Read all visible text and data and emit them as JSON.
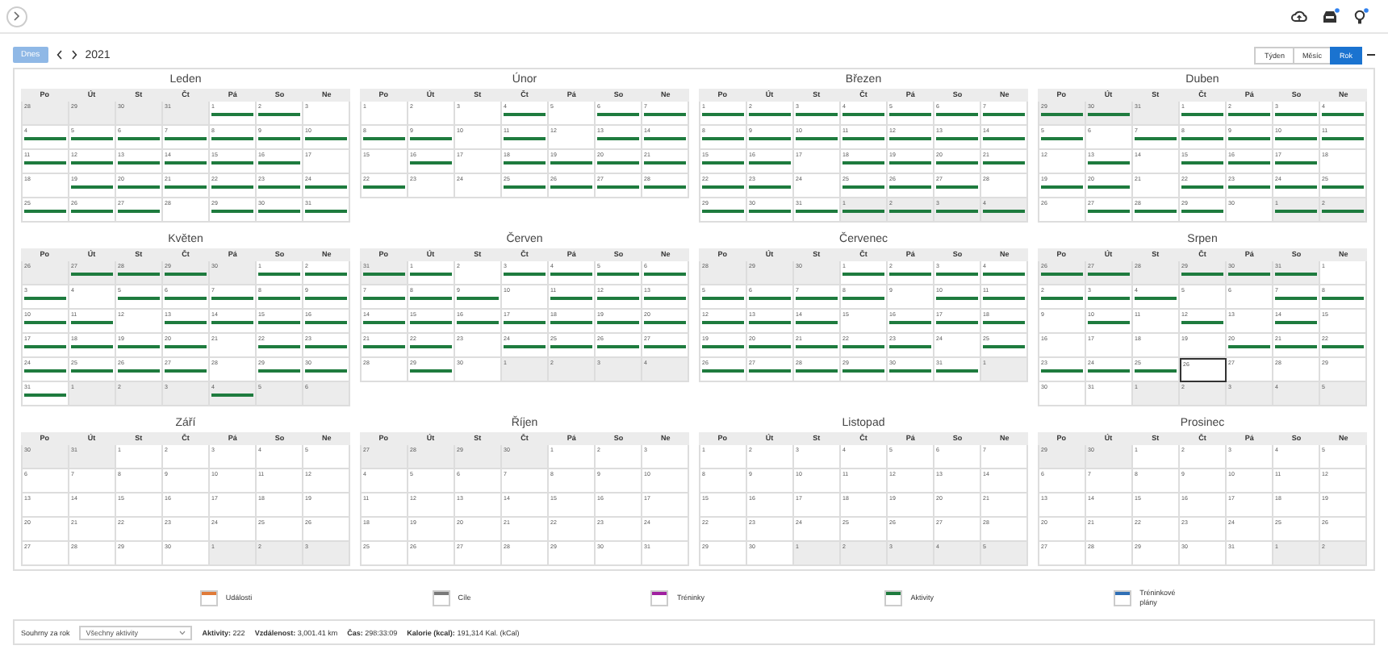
{
  "toolbar": {
    "today_button": "Dnes",
    "year": "2021",
    "views": [
      {
        "label": "Týden",
        "selected": false
      },
      {
        "label": "Měsíc",
        "selected": false
      },
      {
        "label": "Rok",
        "selected": true
      }
    ]
  },
  "months": [
    {
      "name": "Leden",
      "weekdays": [
        "Po",
        "Út",
        "St",
        "Čt",
        "Pá",
        "So",
        "Ne"
      ],
      "weeks": [
        [
          {
            "day": "28",
            "kind": "out"
          },
          {
            "day": "29",
            "kind": "out"
          },
          {
            "day": "30",
            "kind": "out"
          },
          {
            "day": "31",
            "kind": "out"
          },
          {
            "day": "1",
            "kind": "active"
          },
          {
            "day": "2",
            "kind": "active"
          },
          {
            "day": "3",
            "kind": "plain"
          }
        ],
        [
          {
            "day": "4",
            "kind": "active"
          },
          {
            "day": "5",
            "kind": "active"
          },
          {
            "day": "6",
            "kind": "active"
          },
          {
            "day": "7",
            "kind": "active"
          },
          {
            "day": "8",
            "kind": "active"
          },
          {
            "day": "9",
            "kind": "active"
          },
          {
            "day": "10",
            "kind": "active"
          }
        ],
        [
          {
            "day": "11",
            "kind": "active"
          },
          {
            "day": "12",
            "kind": "active"
          },
          {
            "day": "13",
            "kind": "active"
          },
          {
            "day": "14",
            "kind": "active"
          },
          {
            "day": "15",
            "kind": "active"
          },
          {
            "day": "16",
            "kind": "active"
          },
          {
            "day": "17",
            "kind": "plain"
          }
        ],
        [
          {
            "day": "18",
            "kind": "plain"
          },
          {
            "day": "19",
            "kind": "active"
          },
          {
            "day": "20",
            "kind": "active"
          },
          {
            "day": "21",
            "kind": "active"
          },
          {
            "day": "22",
            "kind": "active"
          },
          {
            "day": "23",
            "kind": "active"
          },
          {
            "day": "24",
            "kind": "active"
          }
        ],
        [
          {
            "day": "25",
            "kind": "active"
          },
          {
            "day": "26",
            "kind": "active"
          },
          {
            "day": "27",
            "kind": "active"
          },
          {
            "day": "28",
            "kind": "plain"
          },
          {
            "day": "29",
            "kind": "active"
          },
          {
            "day": "30",
            "kind": "active"
          },
          {
            "day": "31",
            "kind": "active"
          }
        ]
      ]
    },
    {
      "name": "Únor",
      "weekdays": [
        "Po",
        "Út",
        "St",
        "Čt",
        "Pá",
        "So",
        "Ne"
      ],
      "weeks": [
        [
          {
            "day": "1",
            "kind": "plain"
          },
          {
            "day": "2",
            "kind": "plain"
          },
          {
            "day": "3",
            "kind": "plain"
          },
          {
            "day": "4",
            "kind": "active"
          },
          {
            "day": "5",
            "kind": "plain"
          },
          {
            "day": "6",
            "kind": "active"
          },
          {
            "day": "7",
            "kind": "active"
          }
        ],
        [
          {
            "day": "8",
            "kind": "active"
          },
          {
            "day": "9",
            "kind": "active"
          },
          {
            "day": "10",
            "kind": "plain"
          },
          {
            "day": "11",
            "kind": "active"
          },
          {
            "day": "12",
            "kind": "plain"
          },
          {
            "day": "13",
            "kind": "active"
          },
          {
            "day": "14",
            "kind": "active"
          }
        ],
        [
          {
            "day": "15",
            "kind": "plain"
          },
          {
            "day": "16",
            "kind": "active"
          },
          {
            "day": "17",
            "kind": "plain"
          },
          {
            "day": "18",
            "kind": "active"
          },
          {
            "day": "19",
            "kind": "active"
          },
          {
            "day": "20",
            "kind": "active"
          },
          {
            "day": "21",
            "kind": "active"
          }
        ],
        [
          {
            "day": "22",
            "kind": "active"
          },
          {
            "day": "23",
            "kind": "plain"
          },
          {
            "day": "24",
            "kind": "plain"
          },
          {
            "day": "25",
            "kind": "active"
          },
          {
            "day": "26",
            "kind": "active"
          },
          {
            "day": "27",
            "kind": "active"
          },
          {
            "day": "28",
            "kind": "active"
          }
        ]
      ]
    },
    {
      "name": "Březen",
      "weekdays": [
        "Po",
        "Út",
        "St",
        "Čt",
        "Pá",
        "So",
        "Ne"
      ],
      "weeks": [
        [
          {
            "day": "1",
            "kind": "active"
          },
          {
            "day": "2",
            "kind": "active"
          },
          {
            "day": "3",
            "kind": "active"
          },
          {
            "day": "4",
            "kind": "active"
          },
          {
            "day": "5",
            "kind": "active"
          },
          {
            "day": "6",
            "kind": "active"
          },
          {
            "day": "7",
            "kind": "active"
          }
        ],
        [
          {
            "day": "8",
            "kind": "active"
          },
          {
            "day": "9",
            "kind": "active"
          },
          {
            "day": "10",
            "kind": "active"
          },
          {
            "day": "11",
            "kind": "active"
          },
          {
            "day": "12",
            "kind": "active"
          },
          {
            "day": "13",
            "kind": "active"
          },
          {
            "day": "14",
            "kind": "active"
          }
        ],
        [
          {
            "day": "15",
            "kind": "active"
          },
          {
            "day": "16",
            "kind": "active"
          },
          {
            "day": "17",
            "kind": "plain"
          },
          {
            "day": "18",
            "kind": "active"
          },
          {
            "day": "19",
            "kind": "active"
          },
          {
            "day": "20",
            "kind": "active"
          },
          {
            "day": "21",
            "kind": "active"
          }
        ],
        [
          {
            "day": "22",
            "kind": "active"
          },
          {
            "day": "23",
            "kind": "active"
          },
          {
            "day": "24",
            "kind": "plain"
          },
          {
            "day": "25",
            "kind": "active"
          },
          {
            "day": "26",
            "kind": "active"
          },
          {
            "day": "27",
            "kind": "active"
          },
          {
            "day": "28",
            "kind": "plain"
          }
        ],
        [
          {
            "day": "29",
            "kind": "active"
          },
          {
            "day": "30",
            "kind": "active"
          },
          {
            "day": "31",
            "kind": "active"
          },
          {
            "day": "1",
            "kind": "outactive"
          },
          {
            "day": "2",
            "kind": "outactive"
          },
          {
            "day": "3",
            "kind": "outactive"
          },
          {
            "day": "4",
            "kind": "outactive"
          }
        ]
      ]
    },
    {
      "name": "Duben",
      "weekdays": [
        "Po",
        "Út",
        "St",
        "Čt",
        "Pá",
        "So",
        "Ne"
      ],
      "weeks": [
        [
          {
            "day": "29",
            "kind": "outactive"
          },
          {
            "day": "30",
            "kind": "outactive"
          },
          {
            "day": "31",
            "kind": "out"
          },
          {
            "day": "1",
            "kind": "active"
          },
          {
            "day": "2",
            "kind": "active"
          },
          {
            "day": "3",
            "kind": "active"
          },
          {
            "day": "4",
            "kind": "active"
          }
        ],
        [
          {
            "day": "5",
            "kind": "active"
          },
          {
            "day": "6",
            "kind": "plain"
          },
          {
            "day": "7",
            "kind": "active"
          },
          {
            "day": "8",
            "kind": "active"
          },
          {
            "day": "9",
            "kind": "active"
          },
          {
            "day": "10",
            "kind": "active"
          },
          {
            "day": "11",
            "kind": "active"
          }
        ],
        [
          {
            "day": "12",
            "kind": "plain"
          },
          {
            "day": "13",
            "kind": "active"
          },
          {
            "day": "14",
            "kind": "plain"
          },
          {
            "day": "15",
            "kind": "active"
          },
          {
            "day": "16",
            "kind": "active"
          },
          {
            "day": "17",
            "kind": "active"
          },
          {
            "day": "18",
            "kind": "plain"
          }
        ],
        [
          {
            "day": "19",
            "kind": "active"
          },
          {
            "day": "20",
            "kind": "active"
          },
          {
            "day": "21",
            "kind": "plain"
          },
          {
            "day": "22",
            "kind": "active"
          },
          {
            "day": "23",
            "kind": "active"
          },
          {
            "day": "24",
            "kind": "active"
          },
          {
            "day": "25",
            "kind": "active"
          }
        ],
        [
          {
            "day": "26",
            "kind": "plain"
          },
          {
            "day": "27",
            "kind": "active"
          },
          {
            "day": "28",
            "kind": "active"
          },
          {
            "day": "29",
            "kind": "active"
          },
          {
            "day": "30",
            "kind": "plain"
          },
          {
            "day": "1",
            "kind": "outactive"
          },
          {
            "day": "2",
            "kind": "outactive"
          }
        ]
      ]
    },
    {
      "name": "Květen",
      "weekdays": [
        "Po",
        "Út",
        "St",
        "Čt",
        "Pá",
        "So",
        "Ne"
      ],
      "weeks": [
        [
          {
            "day": "26",
            "kind": "out"
          },
          {
            "day": "27",
            "kind": "outactive"
          },
          {
            "day": "28",
            "kind": "outactive"
          },
          {
            "day": "29",
            "kind": "outactive"
          },
          {
            "day": "30",
            "kind": "out"
          },
          {
            "day": "1",
            "kind": "active"
          },
          {
            "day": "2",
            "kind": "active"
          }
        ],
        [
          {
            "day": "3",
            "kind": "active"
          },
          {
            "day": "4",
            "kind": "plain"
          },
          {
            "day": "5",
            "kind": "active"
          },
          {
            "day": "6",
            "kind": "active"
          },
          {
            "day": "7",
            "kind": "active"
          },
          {
            "day": "8",
            "kind": "active"
          },
          {
            "day": "9",
            "kind": "active"
          }
        ],
        [
          {
            "day": "10",
            "kind": "active"
          },
          {
            "day": "11",
            "kind": "active"
          },
          {
            "day": "12",
            "kind": "plain"
          },
          {
            "day": "13",
            "kind": "active"
          },
          {
            "day": "14",
            "kind": "active"
          },
          {
            "day": "15",
            "kind": "active"
          },
          {
            "day": "16",
            "kind": "active"
          }
        ],
        [
          {
            "day": "17",
            "kind": "active"
          },
          {
            "day": "18",
            "kind": "active"
          },
          {
            "day": "19",
            "kind": "active"
          },
          {
            "day": "20",
            "kind": "active"
          },
          {
            "day": "21",
            "kind": "plain"
          },
          {
            "day": "22",
            "kind": "active"
          },
          {
            "day": "23",
            "kind": "active"
          }
        ],
        [
          {
            "day": "24",
            "kind": "active"
          },
          {
            "day": "25",
            "kind": "active"
          },
          {
            "day": "26",
            "kind": "active"
          },
          {
            "day": "27",
            "kind": "active"
          },
          {
            "day": "28",
            "kind": "plain"
          },
          {
            "day": "29",
            "kind": "active"
          },
          {
            "day": "30",
            "kind": "active"
          }
        ],
        [
          {
            "day": "31",
            "kind": "active"
          },
          {
            "day": "1",
            "kind": "out"
          },
          {
            "day": "2",
            "kind": "out"
          },
          {
            "day": "3",
            "kind": "out"
          },
          {
            "day": "4",
            "kind": "outactive"
          },
          {
            "day": "5",
            "kind": "out"
          },
          {
            "day": "6",
            "kind": "out"
          }
        ]
      ]
    },
    {
      "name": "Červen",
      "weekdays": [
        "Po",
        "Út",
        "St",
        "Čt",
        "Pá",
        "So",
        "Ne"
      ],
      "weeks": [
        [
          {
            "day": "31",
            "kind": "outactive"
          },
          {
            "day": "1",
            "kind": "active"
          },
          {
            "day": "2",
            "kind": "plain"
          },
          {
            "day": "3",
            "kind": "active"
          },
          {
            "day": "4",
            "kind": "active"
          },
          {
            "day": "5",
            "kind": "active"
          },
          {
            "day": "6",
            "kind": "active"
          }
        ],
        [
          {
            "day": "7",
            "kind": "active"
          },
          {
            "day": "8",
            "kind": "active"
          },
          {
            "day": "9",
            "kind": "active"
          },
          {
            "day": "10",
            "kind": "plain"
          },
          {
            "day": "11",
            "kind": "active"
          },
          {
            "day": "12",
            "kind": "active"
          },
          {
            "day": "13",
            "kind": "active"
          }
        ],
        [
          {
            "day": "14",
            "kind": "active"
          },
          {
            "day": "15",
            "kind": "active"
          },
          {
            "day": "16",
            "kind": "active"
          },
          {
            "day": "17",
            "kind": "active"
          },
          {
            "day": "18",
            "kind": "active"
          },
          {
            "day": "19",
            "kind": "active"
          },
          {
            "day": "20",
            "kind": "active"
          }
        ],
        [
          {
            "day": "21",
            "kind": "active"
          },
          {
            "day": "22",
            "kind": "active"
          },
          {
            "day": "23",
            "kind": "plain"
          },
          {
            "day": "24",
            "kind": "active"
          },
          {
            "day": "25",
            "kind": "active"
          },
          {
            "day": "26",
            "kind": "active"
          },
          {
            "day": "27",
            "kind": "active"
          }
        ],
        [
          {
            "day": "28",
            "kind": "plain"
          },
          {
            "day": "29",
            "kind": "active"
          },
          {
            "day": "30",
            "kind": "plain"
          },
          {
            "day": "1",
            "kind": "out"
          },
          {
            "day": "2",
            "kind": "out"
          },
          {
            "day": "3",
            "kind": "out"
          },
          {
            "day": "4",
            "kind": "out"
          }
        ]
      ]
    },
    {
      "name": "Červenec",
      "weekdays": [
        "Po",
        "Út",
        "St",
        "Čt",
        "Pá",
        "So",
        "Ne"
      ],
      "weeks": [
        [
          {
            "day": "28",
            "kind": "out"
          },
          {
            "day": "29",
            "kind": "out"
          },
          {
            "day": "30",
            "kind": "out"
          },
          {
            "day": "1",
            "kind": "active"
          },
          {
            "day": "2",
            "kind": "active"
          },
          {
            "day": "3",
            "kind": "active"
          },
          {
            "day": "4",
            "kind": "active"
          }
        ],
        [
          {
            "day": "5",
            "kind": "active"
          },
          {
            "day": "6",
            "kind": "active"
          },
          {
            "day": "7",
            "kind": "active"
          },
          {
            "day": "8",
            "kind": "active"
          },
          {
            "day": "9",
            "kind": "plain"
          },
          {
            "day": "10",
            "kind": "active"
          },
          {
            "day": "11",
            "kind": "active"
          }
        ],
        [
          {
            "day": "12",
            "kind": "active"
          },
          {
            "day": "13",
            "kind": "active"
          },
          {
            "day": "14",
            "kind": "active"
          },
          {
            "day": "15",
            "kind": "plain"
          },
          {
            "day": "16",
            "kind": "active"
          },
          {
            "day": "17",
            "kind": "active"
          },
          {
            "day": "18",
            "kind": "active"
          }
        ],
        [
          {
            "day": "19",
            "kind": "active"
          },
          {
            "day": "20",
            "kind": "active"
          },
          {
            "day": "21",
            "kind": "active"
          },
          {
            "day": "22",
            "kind": "active"
          },
          {
            "day": "23",
            "kind": "active"
          },
          {
            "day": "24",
            "kind": "plain"
          },
          {
            "day": "25",
            "kind": "active"
          }
        ],
        [
          {
            "day": "26",
            "kind": "active"
          },
          {
            "day": "27",
            "kind": "active"
          },
          {
            "day": "28",
            "kind": "active"
          },
          {
            "day": "29",
            "kind": "active"
          },
          {
            "day": "30",
            "kind": "active"
          },
          {
            "day": "31",
            "kind": "active"
          },
          {
            "day": "1",
            "kind": "out"
          }
        ]
      ]
    },
    {
      "name": "Srpen",
      "weekdays": [
        "Po",
        "Út",
        "St",
        "Čt",
        "Pá",
        "So",
        "Ne"
      ],
      "weeks": [
        [
          {
            "day": "26",
            "kind": "outactive"
          },
          {
            "day": "27",
            "kind": "outactive"
          },
          {
            "day": "28",
            "kind": "out"
          },
          {
            "day": "29",
            "kind": "outactive"
          },
          {
            "day": "30",
            "kind": "outactive"
          },
          {
            "day": "31",
            "kind": "outactive"
          },
          {
            "day": "1",
            "kind": "plain"
          }
        ],
        [
          {
            "day": "2",
            "kind": "active"
          },
          {
            "day": "3",
            "kind": "active"
          },
          {
            "day": "4",
            "kind": "active"
          },
          {
            "day": "5",
            "kind": "plain"
          },
          {
            "day": "6",
            "kind": "plain"
          },
          {
            "day": "7",
            "kind": "active"
          },
          {
            "day": "8",
            "kind": "active"
          }
        ],
        [
          {
            "day": "9",
            "kind": "plain"
          },
          {
            "day": "10",
            "kind": "active"
          },
          {
            "day": "11",
            "kind": "plain"
          },
          {
            "day": "12",
            "kind": "active"
          },
          {
            "day": "13",
            "kind": "plain"
          },
          {
            "day": "14",
            "kind": "active"
          },
          {
            "day": "15",
            "kind": "plain"
          }
        ],
        [
          {
            "day": "16",
            "kind": "plain"
          },
          {
            "day": "17",
            "kind": "plain"
          },
          {
            "day": "18",
            "kind": "plain"
          },
          {
            "day": "19",
            "kind": "plain"
          },
          {
            "day": "20",
            "kind": "active"
          },
          {
            "day": "21",
            "kind": "active"
          },
          {
            "day": "22",
            "kind": "active"
          }
        ],
        [
          {
            "day": "23",
            "kind": "active"
          },
          {
            "day": "24",
            "kind": "active"
          },
          {
            "day": "25",
            "kind": "active"
          },
          {
            "day": "26",
            "kind": "today"
          },
          {
            "day": "27",
            "kind": "plain"
          },
          {
            "day": "28",
            "kind": "plain"
          },
          {
            "day": "29",
            "kind": "plain"
          }
        ],
        [
          {
            "day": "30",
            "kind": "plain"
          },
          {
            "day": "31",
            "kind": "plain"
          },
          {
            "day": "1",
            "kind": "out"
          },
          {
            "day": "2",
            "kind": "out"
          },
          {
            "day": "3",
            "kind": "out"
          },
          {
            "day": "4",
            "kind": "out"
          },
          {
            "day": "5",
            "kind": "out"
          }
        ]
      ]
    },
    {
      "name": "Září",
      "weekdays": [
        "Po",
        "Út",
        "St",
        "Čt",
        "Pá",
        "So",
        "Ne"
      ],
      "weeks": [
        [
          {
            "day": "30",
            "kind": "out"
          },
          {
            "day": "31",
            "kind": "out"
          },
          {
            "day": "1",
            "kind": "plain"
          },
          {
            "day": "2",
            "kind": "plain"
          },
          {
            "day": "3",
            "kind": "plain"
          },
          {
            "day": "4",
            "kind": "plain"
          },
          {
            "day": "5",
            "kind": "plain"
          }
        ],
        [
          {
            "day": "6",
            "kind": "plain"
          },
          {
            "day": "7",
            "kind": "plain"
          },
          {
            "day": "8",
            "kind": "plain"
          },
          {
            "day": "9",
            "kind": "plain"
          },
          {
            "day": "10",
            "kind": "plain"
          },
          {
            "day": "11",
            "kind": "plain"
          },
          {
            "day": "12",
            "kind": "plain"
          }
        ],
        [
          {
            "day": "13",
            "kind": "plain"
          },
          {
            "day": "14",
            "kind": "plain"
          },
          {
            "day": "15",
            "kind": "plain"
          },
          {
            "day": "16",
            "kind": "plain"
          },
          {
            "day": "17",
            "kind": "plain"
          },
          {
            "day": "18",
            "kind": "plain"
          },
          {
            "day": "19",
            "kind": "plain"
          }
        ],
        [
          {
            "day": "20",
            "kind": "plain"
          },
          {
            "day": "21",
            "kind": "plain"
          },
          {
            "day": "22",
            "kind": "plain"
          },
          {
            "day": "23",
            "kind": "plain"
          },
          {
            "day": "24",
            "kind": "plain"
          },
          {
            "day": "25",
            "kind": "plain"
          },
          {
            "day": "26",
            "kind": "plain"
          }
        ],
        [
          {
            "day": "27",
            "kind": "plain"
          },
          {
            "day": "28",
            "kind": "plain"
          },
          {
            "day": "29",
            "kind": "plain"
          },
          {
            "day": "30",
            "kind": "plain"
          },
          {
            "day": "1",
            "kind": "out"
          },
          {
            "day": "2",
            "kind": "out"
          },
          {
            "day": "3",
            "kind": "out"
          }
        ]
      ]
    },
    {
      "name": "Říjen",
      "weekdays": [
        "Po",
        "Út",
        "St",
        "Čt",
        "Pá",
        "So",
        "Ne"
      ],
      "weeks": [
        [
          {
            "day": "27",
            "kind": "out"
          },
          {
            "day": "28",
            "kind": "out"
          },
          {
            "day": "29",
            "kind": "out"
          },
          {
            "day": "30",
            "kind": "out"
          },
          {
            "day": "1",
            "kind": "plain"
          },
          {
            "day": "2",
            "kind": "plain"
          },
          {
            "day": "3",
            "kind": "plain"
          }
        ],
        [
          {
            "day": "4",
            "kind": "plain"
          },
          {
            "day": "5",
            "kind": "plain"
          },
          {
            "day": "6",
            "kind": "plain"
          },
          {
            "day": "7",
            "kind": "plain"
          },
          {
            "day": "8",
            "kind": "plain"
          },
          {
            "day": "9",
            "kind": "plain"
          },
          {
            "day": "10",
            "kind": "plain"
          }
        ],
        [
          {
            "day": "11",
            "kind": "plain"
          },
          {
            "day": "12",
            "kind": "plain"
          },
          {
            "day": "13",
            "kind": "plain"
          },
          {
            "day": "14",
            "kind": "plain"
          },
          {
            "day": "15",
            "kind": "plain"
          },
          {
            "day": "16",
            "kind": "plain"
          },
          {
            "day": "17",
            "kind": "plain"
          }
        ],
        [
          {
            "day": "18",
            "kind": "plain"
          },
          {
            "day": "19",
            "kind": "plain"
          },
          {
            "day": "20",
            "kind": "plain"
          },
          {
            "day": "21",
            "kind": "plain"
          },
          {
            "day": "22",
            "kind": "plain"
          },
          {
            "day": "23",
            "kind": "plain"
          },
          {
            "day": "24",
            "kind": "plain"
          }
        ],
        [
          {
            "day": "25",
            "kind": "plain"
          },
          {
            "day": "26",
            "kind": "plain"
          },
          {
            "day": "27",
            "kind": "plain"
          },
          {
            "day": "28",
            "kind": "plain"
          },
          {
            "day": "29",
            "kind": "plain"
          },
          {
            "day": "30",
            "kind": "plain"
          },
          {
            "day": "31",
            "kind": "plain"
          }
        ]
      ]
    },
    {
      "name": "Listopad",
      "weekdays": [
        "Po",
        "Út",
        "St",
        "Čt",
        "Pá",
        "So",
        "Ne"
      ],
      "weeks": [
        [
          {
            "day": "1",
            "kind": "plain"
          },
          {
            "day": "2",
            "kind": "plain"
          },
          {
            "day": "3",
            "kind": "plain"
          },
          {
            "day": "4",
            "kind": "plain"
          },
          {
            "day": "5",
            "kind": "plain"
          },
          {
            "day": "6",
            "kind": "plain"
          },
          {
            "day": "7",
            "kind": "plain"
          }
        ],
        [
          {
            "day": "8",
            "kind": "plain"
          },
          {
            "day": "9",
            "kind": "plain"
          },
          {
            "day": "10",
            "kind": "plain"
          },
          {
            "day": "11",
            "kind": "plain"
          },
          {
            "day": "12",
            "kind": "plain"
          },
          {
            "day": "13",
            "kind": "plain"
          },
          {
            "day": "14",
            "kind": "plain"
          }
        ],
        [
          {
            "day": "15",
            "kind": "plain"
          },
          {
            "day": "16",
            "kind": "plain"
          },
          {
            "day": "17",
            "kind": "plain"
          },
          {
            "day": "18",
            "kind": "plain"
          },
          {
            "day": "19",
            "kind": "plain"
          },
          {
            "day": "20",
            "kind": "plain"
          },
          {
            "day": "21",
            "kind": "plain"
          }
        ],
        [
          {
            "day": "22",
            "kind": "plain"
          },
          {
            "day": "23",
            "kind": "plain"
          },
          {
            "day": "24",
            "kind": "plain"
          },
          {
            "day": "25",
            "kind": "plain"
          },
          {
            "day": "26",
            "kind": "plain"
          },
          {
            "day": "27",
            "kind": "plain"
          },
          {
            "day": "28",
            "kind": "plain"
          }
        ],
        [
          {
            "day": "29",
            "kind": "plain"
          },
          {
            "day": "30",
            "kind": "plain"
          },
          {
            "day": "1",
            "kind": "out"
          },
          {
            "day": "2",
            "kind": "out"
          },
          {
            "day": "3",
            "kind": "out"
          },
          {
            "day": "4",
            "kind": "out"
          },
          {
            "day": "5",
            "kind": "out"
          }
        ]
      ]
    },
    {
      "name": "Prosinec",
      "weekdays": [
        "Po",
        "Út",
        "St",
        "Čt",
        "Pá",
        "So",
        "Ne"
      ],
      "weeks": [
        [
          {
            "day": "29",
            "kind": "out"
          },
          {
            "day": "30",
            "kind": "out"
          },
          {
            "day": "1",
            "kind": "plain"
          },
          {
            "day": "2",
            "kind": "plain"
          },
          {
            "day": "3",
            "kind": "plain"
          },
          {
            "day": "4",
            "kind": "plain"
          },
          {
            "day": "5",
            "kind": "plain"
          }
        ],
        [
          {
            "day": "6",
            "kind": "plain"
          },
          {
            "day": "7",
            "kind": "plain"
          },
          {
            "day": "8",
            "kind": "plain"
          },
          {
            "day": "9",
            "kind": "plain"
          },
          {
            "day": "10",
            "kind": "plain"
          },
          {
            "day": "11",
            "kind": "plain"
          },
          {
            "day": "12",
            "kind": "plain"
          }
        ],
        [
          {
            "day": "13",
            "kind": "plain"
          },
          {
            "day": "14",
            "kind": "plain"
          },
          {
            "day": "15",
            "kind": "plain"
          },
          {
            "day": "16",
            "kind": "plain"
          },
          {
            "day": "17",
            "kind": "plain"
          },
          {
            "day": "18",
            "kind": "plain"
          },
          {
            "day": "19",
            "kind": "plain"
          }
        ],
        [
          {
            "day": "20",
            "kind": "plain"
          },
          {
            "day": "21",
            "kind": "plain"
          },
          {
            "day": "22",
            "kind": "plain"
          },
          {
            "day": "23",
            "kind": "plain"
          },
          {
            "day": "24",
            "kind": "plain"
          },
          {
            "day": "25",
            "kind": "plain"
          },
          {
            "day": "26",
            "kind": "plain"
          }
        ],
        [
          {
            "day": "27",
            "kind": "plain"
          },
          {
            "day": "28",
            "kind": "plain"
          },
          {
            "day": "29",
            "kind": "plain"
          },
          {
            "day": "30",
            "kind": "plain"
          },
          {
            "day": "31",
            "kind": "plain"
          },
          {
            "day": "1",
            "kind": "out"
          },
          {
            "day": "2",
            "kind": "out"
          }
        ]
      ]
    }
  ],
  "legend": [
    {
      "label": "Události",
      "color": "#e07b39"
    },
    {
      "label": "Cíle",
      "color": "#7a7a7a"
    },
    {
      "label": "Tréninky",
      "color": "#a020a0"
    },
    {
      "label": "Aktivity",
      "color": "#1e7b3e"
    },
    {
      "label": "Tréninkové plány",
      "color": "#2f6fb5"
    }
  ],
  "summary": {
    "label": "Souhrny za rok",
    "select": {
      "value": "Všechny aktivity"
    },
    "stats": [
      {
        "label": "Aktivity:",
        "value": "222"
      },
      {
        "label": "Vzdálenost:",
        "value": "3,001.41 km"
      },
      {
        "label": "Čas:",
        "value": "298:33:09"
      },
      {
        "label": "Kalorie (kcal):",
        "value": "191,314 Kal. (kCal)"
      }
    ]
  }
}
